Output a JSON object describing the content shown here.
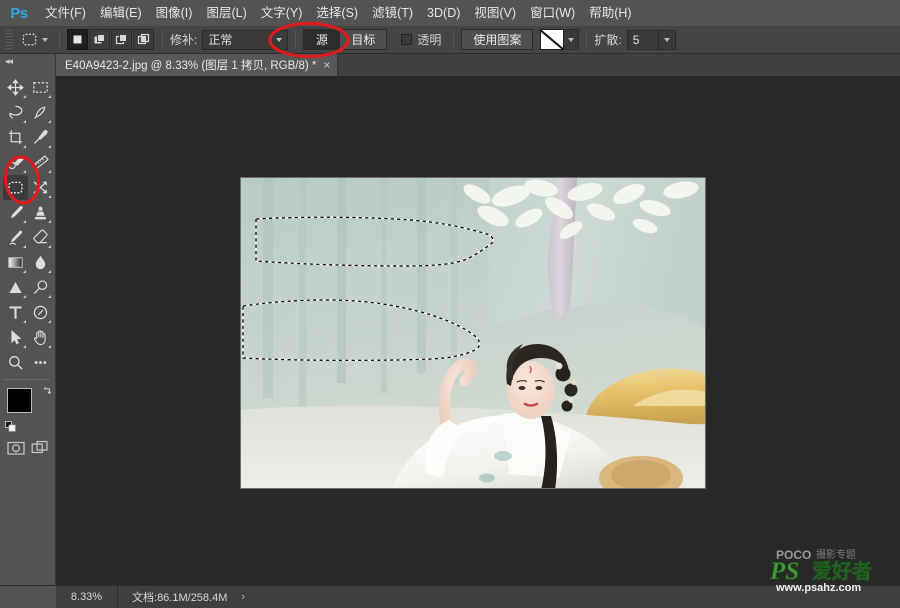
{
  "app": {
    "logo": "Ps",
    "name": "Adobe Photoshop"
  },
  "menubar": {
    "items": [
      {
        "label": "文件(F)",
        "name": "menu-file"
      },
      {
        "label": "编辑(E)",
        "name": "menu-edit"
      },
      {
        "label": "图像(I)",
        "name": "menu-image"
      },
      {
        "label": "图层(L)",
        "name": "menu-layer"
      },
      {
        "label": "文字(Y)",
        "name": "menu-type"
      },
      {
        "label": "选择(S)",
        "name": "menu-select"
      },
      {
        "label": "滤镜(T)",
        "name": "menu-filter"
      },
      {
        "label": "3D(D)",
        "name": "menu-3d"
      },
      {
        "label": "视图(V)",
        "name": "menu-view"
      },
      {
        "label": "窗口(W)",
        "name": "menu-window"
      },
      {
        "label": "帮助(H)",
        "name": "menu-help"
      }
    ]
  },
  "options_bar": {
    "tool": "patch-tool",
    "selection_modes": [
      "new-selection",
      "add-to-selection",
      "subtract-from-selection",
      "intersect-with-selection"
    ],
    "active_selection_mode": "new-selection",
    "patch_label": "修补:",
    "patch_mode": "正常",
    "source_label": "源",
    "target_label": "目标",
    "active_source_target": "源",
    "transparent_label": "透明",
    "transparent_checked": false,
    "use_pattern_label": "使用图案",
    "diffusion_label": "扩散:",
    "diffusion_value": "5"
  },
  "document": {
    "tab_title": "E40A9423-2.jpg @ 8.33% (图层 1 拷贝, RGB/8) *",
    "close_glyph": "×",
    "filename": "E40A9423-2.jpg",
    "zoom": "8.33%",
    "layer": "图层 1 拷贝",
    "color_mode": "RGB/8",
    "modified": true
  },
  "toolbar": {
    "collapse_glyph": "◂◂",
    "tools": [
      {
        "name": "move-tool",
        "label": "移动工具",
        "icon": "move-icon",
        "has_flyout": true,
        "active": false
      },
      {
        "name": "marquee-tool",
        "label": "矩形选框工具",
        "icon": "marquee-icon",
        "has_flyout": true,
        "active": false
      },
      {
        "name": "lasso-tool",
        "label": "套索工具",
        "icon": "lasso-icon",
        "has_flyout": true,
        "active": false
      },
      {
        "name": "quick-selection-tool",
        "label": "快速选择工具",
        "icon": "quick-selection-icon",
        "has_flyout": true,
        "active": false
      },
      {
        "name": "crop-tool",
        "label": "裁剪工具",
        "icon": "crop-icon",
        "has_flyout": true,
        "active": false
      },
      {
        "name": "eyedropper-tool",
        "label": "吸管工具",
        "icon": "eyedropper-icon",
        "has_flyout": true,
        "active": false
      },
      {
        "name": "healing-brush-tool",
        "label": "污点修复画笔工具",
        "icon": "healing-brush-icon",
        "has_flyout": true,
        "active": false
      },
      {
        "name": "ruler-tool",
        "label": "标尺工具",
        "icon": "ruler-icon",
        "has_flyout": true,
        "active": false
      },
      {
        "name": "patch-tool",
        "label": "修补工具",
        "icon": "patch-icon",
        "has_flyout": false,
        "active": true
      },
      {
        "name": "shuffle-tool",
        "label": "内容感知移动工具",
        "icon": "shuffle-icon",
        "has_flyout": true,
        "active": false
      },
      {
        "name": "brush-tool",
        "label": "画笔工具",
        "icon": "brush-icon",
        "has_flyout": true,
        "active": false
      },
      {
        "name": "clone-stamp-tool",
        "label": "仿制图章工具",
        "icon": "clone-stamp-icon",
        "has_flyout": true,
        "active": false
      },
      {
        "name": "history-brush-tool",
        "label": "历史记录画笔工具",
        "icon": "history-brush-icon",
        "has_flyout": true,
        "active": false
      },
      {
        "name": "eraser-tool",
        "label": "橡皮擦工具",
        "icon": "eraser-icon",
        "has_flyout": true,
        "active": false
      },
      {
        "name": "gradient-tool",
        "label": "渐变工具",
        "icon": "gradient-icon",
        "has_flyout": true,
        "active": false
      },
      {
        "name": "blur-tool",
        "label": "模糊工具",
        "icon": "blur-icon",
        "has_flyout": true,
        "active": false
      },
      {
        "name": "dodge-tool",
        "label": "减淡工具",
        "icon": "dodge-icon",
        "has_flyout": true,
        "active": false
      },
      {
        "name": "pen-tool",
        "label": "钢笔工具",
        "icon": "pen-icon",
        "has_flyout": true,
        "active": false
      },
      {
        "name": "type-tool",
        "label": "横排文字工具",
        "icon": "type-icon",
        "has_flyout": true,
        "active": false
      },
      {
        "name": "ellipse-tool",
        "label": "椭圆工具",
        "icon": "ellipse-icon",
        "has_flyout": true,
        "active": false
      },
      {
        "name": "path-selection-tool",
        "label": "路径选择工具",
        "icon": "path-selection-icon",
        "has_flyout": true,
        "active": false
      },
      {
        "name": "hand-tool",
        "label": "抓手工具",
        "icon": "hand-icon",
        "has_flyout": true,
        "active": false
      },
      {
        "name": "zoom-tool",
        "label": "缩放工具",
        "icon": "zoom-icon",
        "has_flyout": false,
        "active": false
      },
      {
        "name": "edit-toolbar-tool",
        "label": "编辑工具栏",
        "icon": "ellipsis-icon",
        "has_flyout": false,
        "active": false
      }
    ],
    "foreground_color": "#000000",
    "background_color": "#ffffff",
    "quick_mask": "以快速蒙版模式编辑",
    "screen_mode": "更改屏幕模式"
  },
  "statusbar": {
    "zoom": "8.33%",
    "doc_label": "文档:",
    "doc_size": "86.1M/258.4M",
    "expand_glyph": "›"
  },
  "annotations": [
    {
      "name": "annotation-circle-patch-tool",
      "target": "patch-tool",
      "color": "#e01b1b"
    },
    {
      "name": "annotation-circle-source-target",
      "target": "source-target-buttons",
      "color": "#e01b1b"
    }
  ],
  "canvas": {
    "selection": "两个不规则套索选区（蚂蚁线）",
    "image_alt": "身着白色汉服的女子坐在浅色布景前"
  },
  "watermark": {
    "brand": "POCO",
    "brand_sub": "摄影专题",
    "logo_ps": "PS",
    "logo_cn": "爱好者",
    "url": "www.psahz.com",
    "color": "#3e9e3a"
  },
  "colors": {
    "menubar_bg": "#535353",
    "options_bg": "#454545",
    "panel_bg": "#535353",
    "canvas_bg": "#282828",
    "tab_bg": "#585858",
    "status_bg": "#3f3f3f",
    "accent_blue": "#2fa8e0",
    "annotation_red": "#e01b1b"
  }
}
